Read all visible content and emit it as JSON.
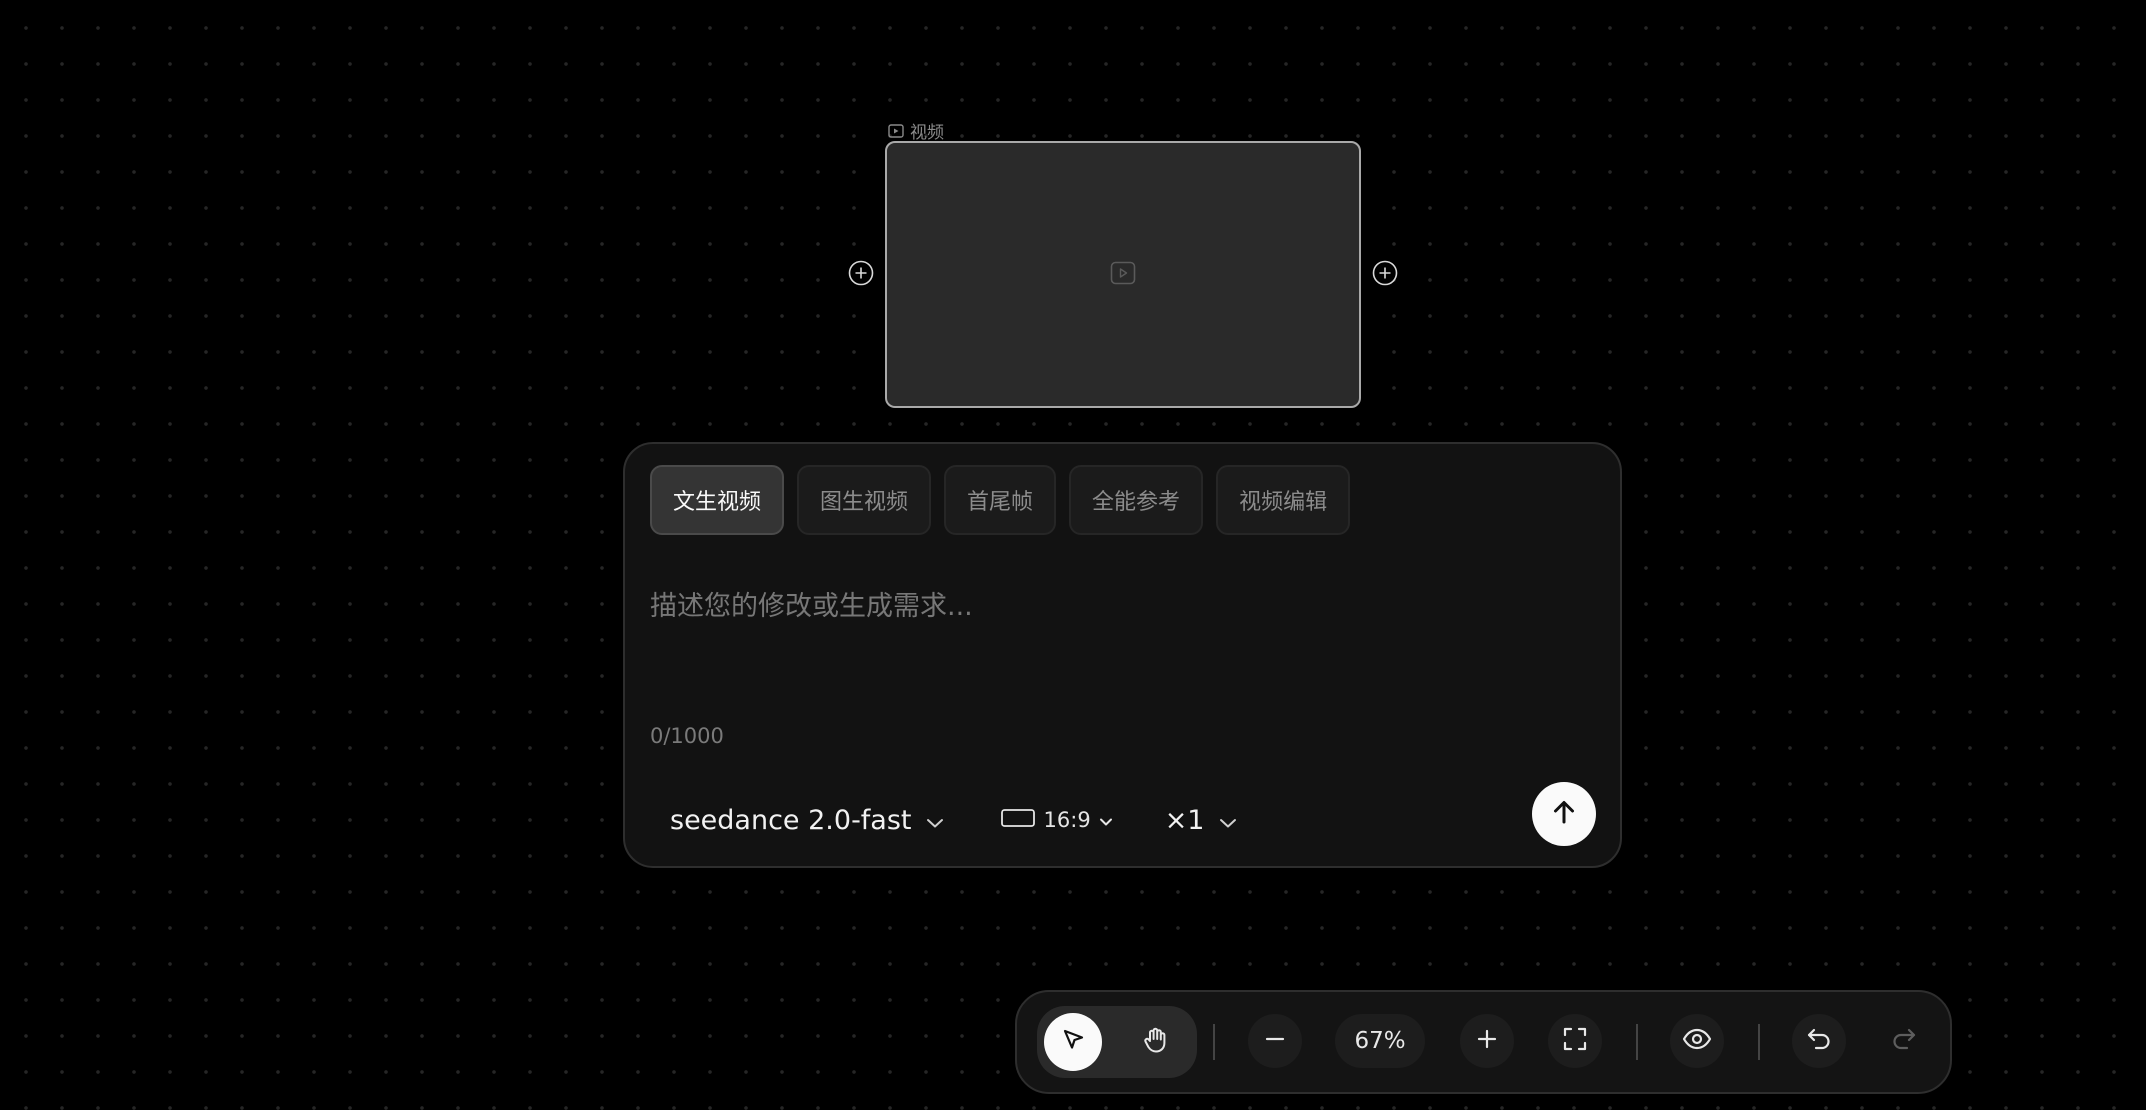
{
  "canvas": {
    "node": {
      "label": "视频",
      "label_icon": "video-icon",
      "placeholder_icon": "play-icon"
    },
    "connectors": [
      "plus-icon",
      "plus-icon"
    ]
  },
  "prompt_panel": {
    "tabs": [
      {
        "label": "文生视频",
        "active": true
      },
      {
        "label": "图生视频",
        "active": false
      },
      {
        "label": "首尾帧",
        "active": false
      },
      {
        "label": "全能参考",
        "active": false
      },
      {
        "label": "视频编辑",
        "active": false
      }
    ],
    "input": {
      "value": "",
      "placeholder": "描述您的修改或生成需求..."
    },
    "char_count": "0/1000",
    "model": "seedance 2.0-fast",
    "aspect_ratio": "16:9",
    "count": "×1",
    "send_icon": "arrow-up-icon"
  },
  "toolbar": {
    "zoom": "67%",
    "tools": [
      "cursor-icon",
      "hand-icon",
      "minus-icon",
      "plus-icon",
      "fullscreen-icon",
      "eye-icon",
      "undo-icon",
      "redo-icon"
    ],
    "active_tool": "cursor-icon"
  },
  "colors": {
    "background": "#000000",
    "panel": "#121212",
    "accent": "#fafafa",
    "muted_text": "#8c8c8c"
  }
}
